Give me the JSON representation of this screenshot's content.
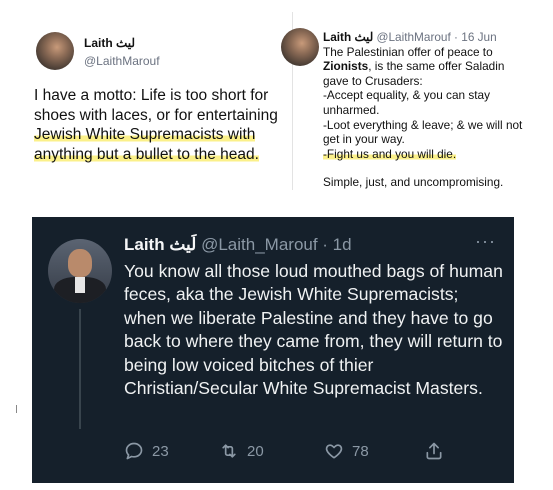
{
  "tweet_top_left": {
    "name": "Laith لیث",
    "handle": "@LaithMarouf",
    "text_before": "I have a motto: Life is too short for shoes with laces, or for entertaining ",
    "text_highlighted": "Jewish White Supremacists with anything but a bullet to the head."
  },
  "tweet_top_right": {
    "name": "Laith لیث",
    "handle_time": "@LaithMarouf · 16 Jun",
    "line_intro": "The Palestinian offer of peace to",
    "bold_word": "Zionists",
    "line_intro_rest": ", is the same offer Saladin gave to Crusaders:",
    "line_1": "-Accept equality, & you can stay unharmed.",
    "line_2": "-Loot everything & leave; & we will not get in your way.",
    "line_3": "-Fight us and you will die.",
    "closing": "Simple, just, and uncompromising."
  },
  "tweet_dark": {
    "name": "Laith لَيث",
    "handle_time": "@Laith_Marouf · 1d",
    "more": "···",
    "text": "You know all those loud mouthed bags of human feces, aka the Jewish White Supremacists; when we liberate Palestine and they have to go back to where they came from, they will return to being low voiced bitches of thier Christian/Secular White Supremacist Masters.",
    "replies": "23",
    "retweets": "20",
    "likes": "78",
    "icons": [
      "reply-icon",
      "retweet-icon",
      "like-icon",
      "share-icon"
    ],
    "colors": {
      "background": "#15202b",
      "text": "#e7e9ea",
      "muted": "#8b98a5"
    }
  },
  "highlight_color": "#fbf08a"
}
